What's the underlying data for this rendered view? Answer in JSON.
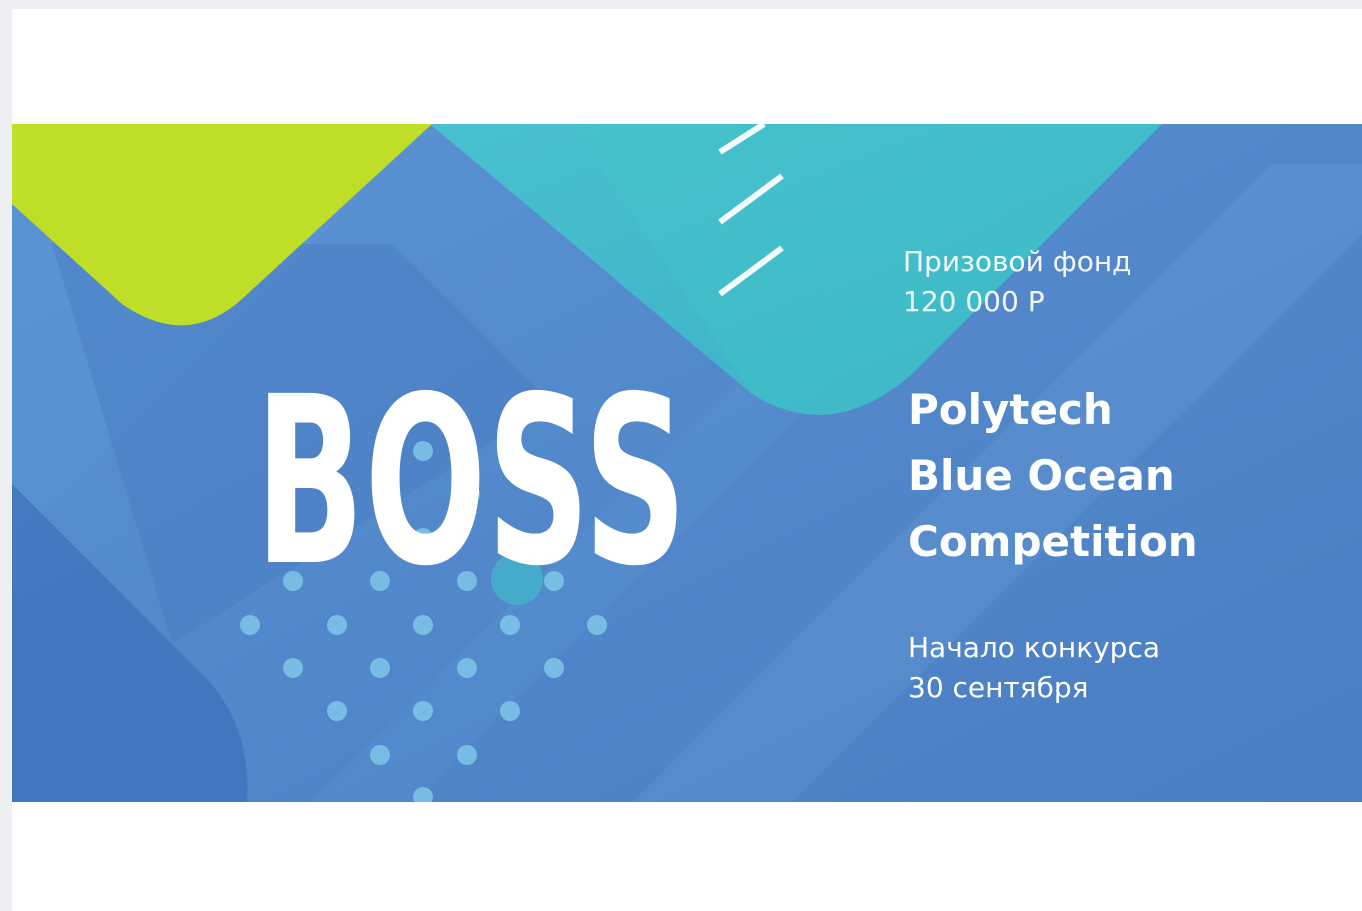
{
  "banner": {
    "logo_text": "BOSS",
    "prize": {
      "label": "Призовой фонд",
      "amount": "120 000 Р"
    },
    "title_lines": [
      "Polytech",
      "Blue Ocean",
      "Competition"
    ],
    "start": {
      "label": "Начало конкурса",
      "date": "30 сентября"
    }
  },
  "colors": {
    "background_blue": "#4f86c8",
    "lime_accent": "#bfde27",
    "teal_accent": "#3fc2cc",
    "dot_color": "#7fc6e8",
    "text": "#ffffff"
  }
}
